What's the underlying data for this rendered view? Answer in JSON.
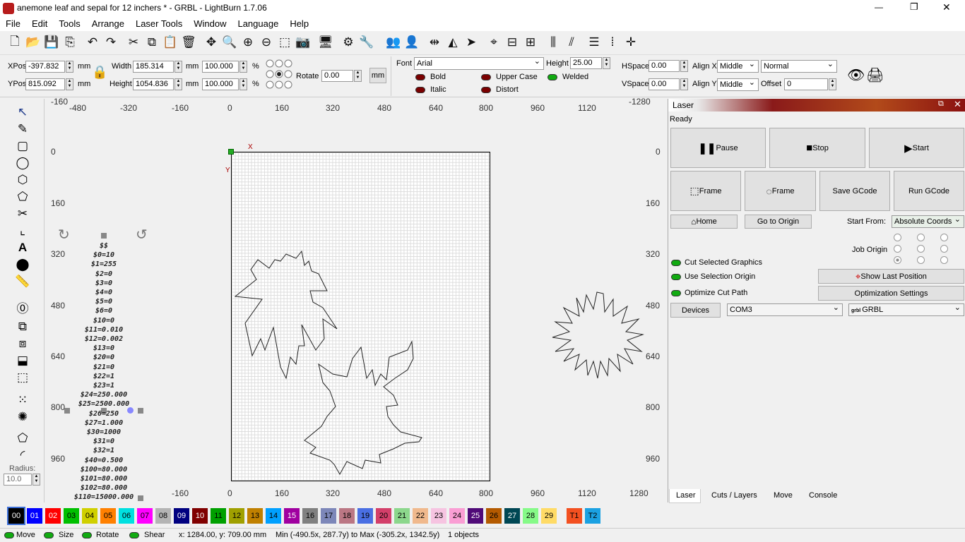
{
  "window": {
    "title": "anemone leaf and sepal for 12 inchers * - GRBL - LightBurn 1.7.06",
    "minimize": "—",
    "maximize": "❐",
    "close": "✕"
  },
  "menu": [
    "File",
    "Edit",
    "Tools",
    "Arrange",
    "Laser Tools",
    "Window",
    "Language",
    "Help"
  ],
  "props": {
    "xpos_label": "XPos",
    "xpos": "-397.832",
    "ypos_label": "YPos",
    "ypos": "815.092",
    "mm": "mm",
    "width_label": "Width",
    "width": "185.314",
    "height_label": "Height",
    "height": "1054.836",
    "wpct": "100.000",
    "hpct": "100.000",
    "pct": "%",
    "rotate_label": "Rotate",
    "rotate": "0.00",
    "mm_btn": "mm",
    "font_label": "Font",
    "font": "Arial",
    "fheight_label": "Height",
    "fheight": "25.00",
    "bold": "Bold",
    "italic": "Italic",
    "upper": "Upper Case",
    "distort": "Distort",
    "welded": "Welded",
    "hspace_label": "HSpace",
    "hspace": "0.00",
    "vspace_label": "VSpace",
    "vspace": "0.00",
    "alignx_label": "Align X",
    "alignx": "Middle",
    "aligny_label": "Align Y",
    "aligny": "Middle",
    "mode": "Normal",
    "offset_label": "Offset",
    "offset": "0"
  },
  "rulers": {
    "top": [
      "-160",
      "-480",
      "-320",
      "-160",
      "0",
      "160",
      "320",
      "480",
      "640",
      "800",
      "960",
      "1120",
      "-1280"
    ],
    "bottom": [
      "-160",
      "0",
      "160",
      "320",
      "480",
      "640",
      "800",
      "960",
      "1120",
      "1280"
    ],
    "left": [
      "0",
      "160",
      "320",
      "480",
      "640",
      "800",
      "960"
    ],
    "right": [
      "0",
      "160",
      "320",
      "480",
      "640",
      "800",
      "960"
    ]
  },
  "canvas": {
    "x_label": "X",
    "y_label": "Y"
  },
  "gcode_text": [
    "$$",
    "$0=10",
    "$1=255",
    "$2=0",
    "$3=0",
    "$4=0",
    "$5=0",
    "$6=0",
    "$10=0",
    "$11=0.010",
    "$12=0.002",
    "$13=0",
    "$20=0",
    "$21=0",
    "$22=1",
    "$23=1",
    "$24=250.000",
    "$25=2500.000",
    "$26=250",
    "$27=1.000",
    "$30=1000",
    "$31=0",
    "$32=1",
    "$40=0.500",
    "$100=80.000",
    "$101=80.000",
    "$102=80.000",
    "$110=15000.000"
  ],
  "laser": {
    "title": "Laser",
    "status": "Ready",
    "pause": "Pause",
    "stop": "Stop",
    "start": "Start",
    "frame1": "Frame",
    "frame2": "Frame",
    "save_gcode": "Save GCode",
    "run_gcode": "Run GCode",
    "home": "Home",
    "go_origin": "Go to Origin",
    "start_from_label": "Start From:",
    "start_from": "Absolute Coords",
    "job_origin": "Job Origin",
    "cut_selected": "Cut Selected Graphics",
    "use_selection": "Use Selection Origin",
    "optimize": "Optimize Cut Path",
    "show_last": "Show Last Position",
    "opt_settings": "Optimization Settings",
    "devices": "Devices",
    "port": "COM3",
    "device": "GRBL",
    "grbl_logo": "grbl"
  },
  "tabs": [
    "Laser",
    "Cuts / Layers",
    "Move",
    "Console"
  ],
  "palette": [
    {
      "l": "00",
      "c": "#000000"
    },
    {
      "l": "01",
      "c": "#0000ff"
    },
    {
      "l": "02",
      "c": "#ff0000"
    },
    {
      "l": "03",
      "c": "#00c000"
    },
    {
      "l": "04",
      "c": "#d0d000"
    },
    {
      "l": "05",
      "c": "#ff8000"
    },
    {
      "l": "06",
      "c": "#00e0e0"
    },
    {
      "l": "07",
      "c": "#ff00ff"
    },
    {
      "l": "08",
      "c": "#b4b4b4"
    },
    {
      "l": "09",
      "c": "#000080"
    },
    {
      "l": "10",
      "c": "#800000"
    },
    {
      "l": "11",
      "c": "#00a000"
    },
    {
      "l": "12",
      "c": "#a0a000"
    },
    {
      "l": "13",
      "c": "#c08000"
    },
    {
      "l": "14",
      "c": "#00a0ff"
    },
    {
      "l": "15",
      "c": "#a000a0"
    },
    {
      "l": "16",
      "c": "#808080"
    },
    {
      "l": "17",
      "c": "#7d87b9"
    },
    {
      "l": "18",
      "c": "#bb7784"
    },
    {
      "l": "19",
      "c": "#4a6fe3"
    },
    {
      "l": "20",
      "c": "#d33f6a"
    },
    {
      "l": "21",
      "c": "#8cd78c"
    },
    {
      "l": "22",
      "c": "#f0b98d"
    },
    {
      "l": "23",
      "c": "#f6c4e1"
    },
    {
      "l": "24",
      "c": "#fa9ed4"
    },
    {
      "l": "25",
      "c": "#500a78"
    },
    {
      "l": "26",
      "c": "#b45a00"
    },
    {
      "l": "27",
      "c": "#004754"
    },
    {
      "l": "28",
      "c": "#86fa88"
    },
    {
      "l": "29",
      "c": "#ffdb66"
    },
    {
      "l": "T1",
      "c": "#f35020"
    },
    {
      "l": "T2",
      "c": "#1ba1e2"
    }
  ],
  "status": {
    "move": "Move",
    "size": "Size",
    "rotate": "Rotate",
    "shear": "Shear",
    "coords": "x: 1284.00, y: 709.00 mm",
    "range": "Min (-490.5x, 287.7y) to Max (-305.2x, 1342.5y)",
    "objects": "1 objects"
  },
  "left_tools": {
    "radius_label": "Radius:",
    "radius": "10.0"
  }
}
